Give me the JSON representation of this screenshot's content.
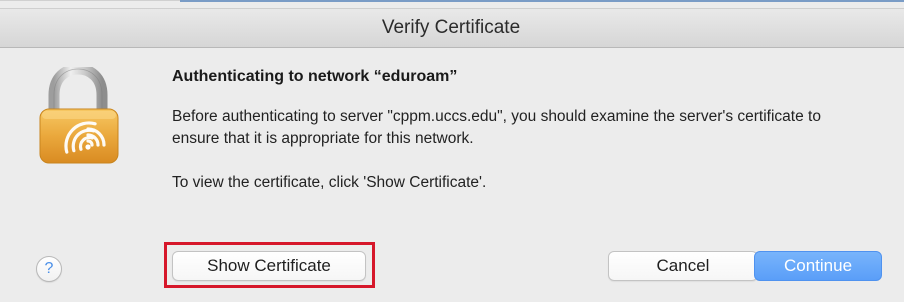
{
  "window": {
    "title": "Verify Certificate"
  },
  "dialog": {
    "icon": "lock-wifi-icon",
    "heading": "Authenticating to network “eduroam”",
    "body": "Before authenticating to server \"cppm.uccs.edu\", you should examine the server's certificate to ensure that it is appropriate for this network.",
    "hint": "To view the certificate, click 'Show Certificate'."
  },
  "buttons": {
    "help_label": "?",
    "show_certificate_label": "Show Certificate",
    "cancel_label": "Cancel",
    "continue_label": "Continue"
  },
  "colors": {
    "accent_blue": "#5a9ef8",
    "highlight_red": "#d6172a",
    "lock_gold": "#e9a63a"
  }
}
